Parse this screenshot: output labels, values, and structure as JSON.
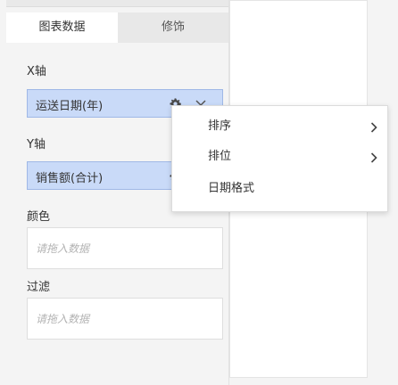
{
  "tabs": {
    "data_label": "图表数据",
    "decorate_label": "修饰"
  },
  "x_axis": {
    "label": "X轴",
    "field": "运送日期(年)"
  },
  "y_axis": {
    "label": "Y轴",
    "field": "销售额(合计)"
  },
  "color": {
    "label": "颜色",
    "placeholder": "请拖入数据"
  },
  "filter": {
    "label": "过滤",
    "placeholder": "请拖入数据"
  },
  "context_menu": {
    "items": [
      {
        "label": "排序",
        "icon": "chevron-right-icon"
      },
      {
        "label": "排位",
        "icon": "chevron-right-icon"
      },
      {
        "label": "日期格式"
      }
    ]
  },
  "colors": {
    "pill_bg": "#c9daf8",
    "pill_border": "#9fb8e6",
    "panel_bg": "#f4f4f4"
  }
}
